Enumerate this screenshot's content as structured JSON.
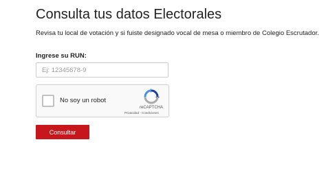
{
  "header": {
    "title": "Consulta tus datos Electorales",
    "subtitle": "Revisa tu local de votación y si fuiste designado vocal de mesa o miembro de Colegio Escrutador."
  },
  "form": {
    "run_label": "Ingrese su RUN:",
    "run_placeholder": "Ej: 12345678-9",
    "run_value": "",
    "submit_label": "Consultar"
  },
  "recaptcha": {
    "checkbox_label": "No soy un robot",
    "brand": "reCAPTCHA",
    "privacy_link": "Privacidad",
    "separator": " - ",
    "terms_link": "Condiciones",
    "logo_icon": "recaptcha-logo-icon",
    "checked": false
  },
  "colors": {
    "accent": "#c8161d",
    "text": "#222222",
    "recaptcha_blue": "#1c3aa9",
    "recaptcha_lightblue": "#4a90e2",
    "recaptcha_gray": "#ababab"
  }
}
